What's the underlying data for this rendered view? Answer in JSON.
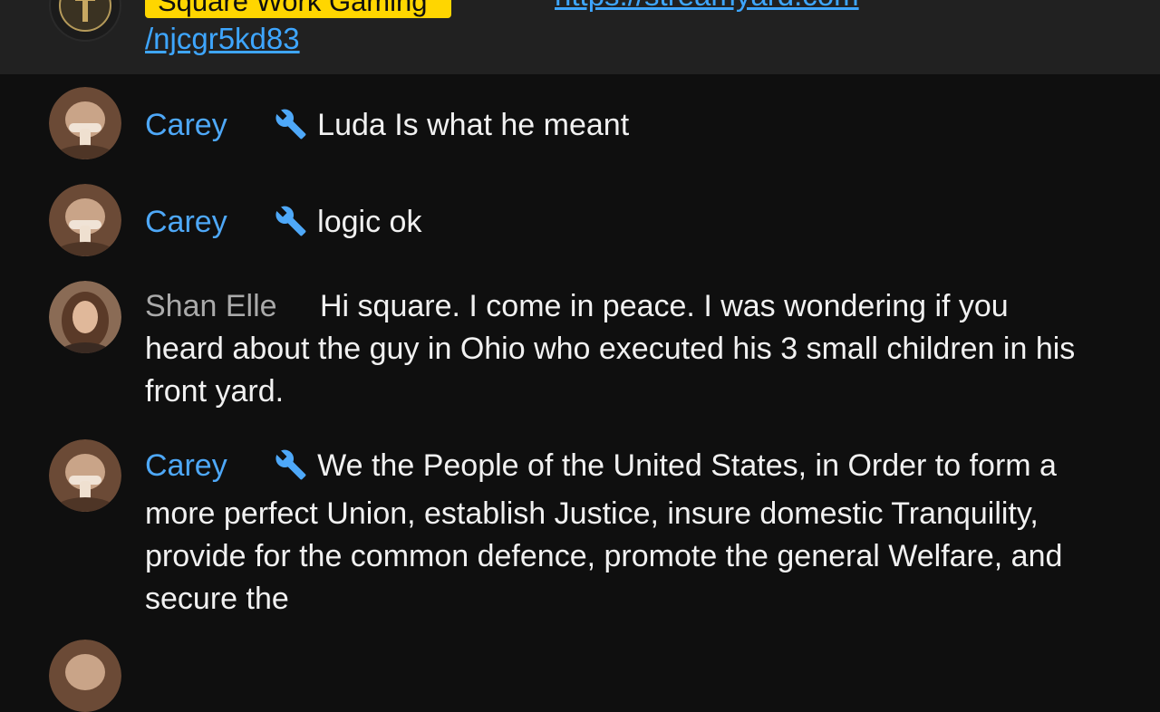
{
  "pinned": {
    "author_badge": "Square Work Gaming",
    "link_line1": "https://streamyard.com",
    "link_line2": "/njcgr5kd83"
  },
  "messages": [
    {
      "author": "Carey",
      "text": "Luda Is what he meant",
      "moderator": true
    },
    {
      "author": "Carey",
      "text": "logic ok",
      "moderator": true
    },
    {
      "author": "Shan Elle",
      "text": "Hi square. I come in peace. I was wondering if you heard about the guy in Ohio who executed his 3 small children in his front yard.",
      "moderator": false
    },
    {
      "author": "Carey",
      "text": "We the People of the United States, in Order to form a more perfect Union, establish Justice, insure domestic Tranquility, provide for the common defence, promote the general Welfare, and secure the",
      "moderator": true
    }
  ],
  "colors": {
    "moderator_name": "#4ea8f8",
    "regular_name": "#aaaaaa",
    "owner_badge": "#ffd600",
    "link": "#3ea6ff",
    "background": "#0f0f0f"
  }
}
